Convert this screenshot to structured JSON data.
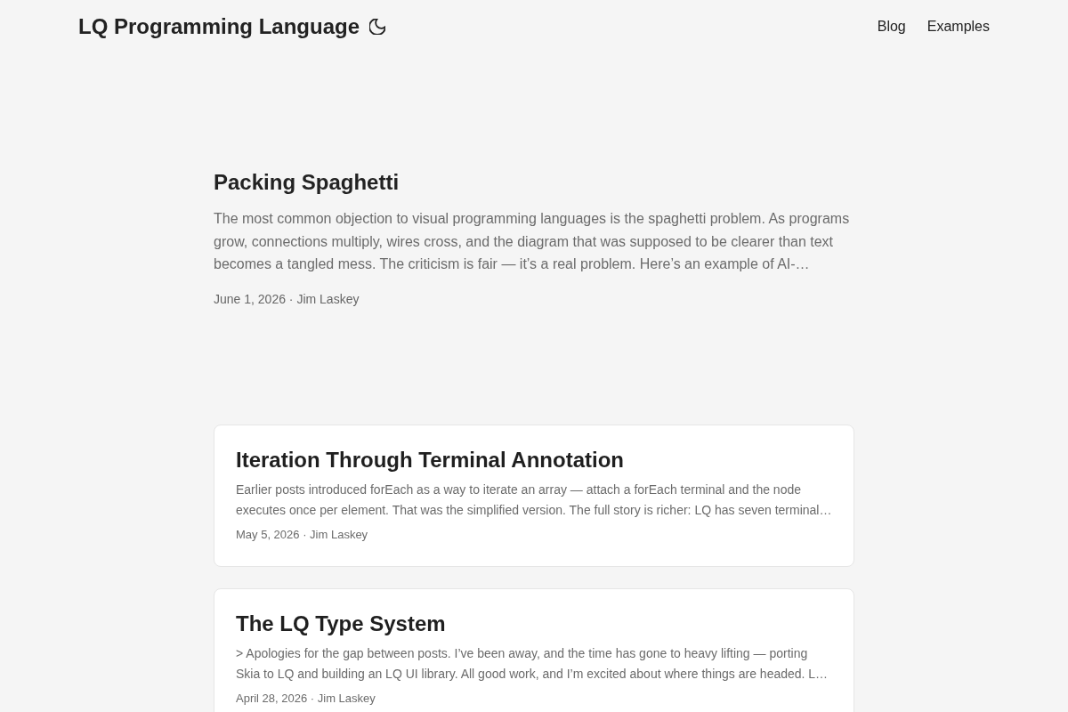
{
  "header": {
    "site_title": "LQ Programming Language",
    "nav": [
      {
        "label": "Blog"
      },
      {
        "label": "Examples"
      }
    ]
  },
  "featured_post": {
    "title": "Packing Spaghetti",
    "excerpt": "The most common objection to visual programming languages is the spaghetti problem. As programs grow, connections multiply, wires cross, and the diagram that was supposed to be clearer than text becomes a tangled mess. The criticism is fair — it’s a real problem. Here’s an example of AI-…",
    "meta": "June 1, 2026 · Jim Laskey"
  },
  "posts": [
    {
      "title": "Iteration Through Terminal Annotation",
      "excerpt": "Earlier posts introduced forEach as a way to iterate an array — attach a forEach terminal and the node executes once per element. That was the simplified version. The full story is richer: LQ has seven terminal…",
      "meta": "May 5, 2026 · Jim Laskey"
    },
    {
      "title": "The LQ Type System",
      "excerpt": "> Apologies for the gap between posts. I’ve been away, and the time has gone to heavy lifting — porting Skia to LQ and building an LQ UI library. All good work, and I’m excited about where things are headed. L…",
      "meta": "April 28, 2026 · Jim Laskey"
    }
  ]
}
